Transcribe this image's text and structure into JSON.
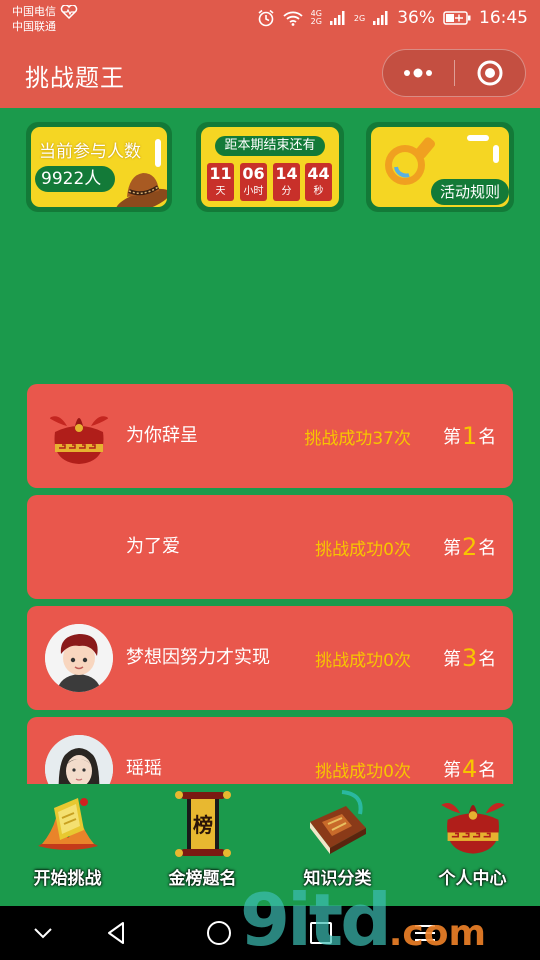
{
  "status_bar": {
    "carrier1": "中国电信",
    "carrier2": "中国联通",
    "net1": "4G",
    "net2": "2G",
    "battery": "36%",
    "time": "16:45"
  },
  "title_bar": {
    "title": "挑战题王"
  },
  "cards": {
    "participants": {
      "label": "当前参与人数",
      "count": "9922人"
    },
    "countdown": {
      "heading": "距本期结束还有",
      "units": [
        {
          "num": "11",
          "unit": "天"
        },
        {
          "num": "06",
          "unit": "小时"
        },
        {
          "num": "14",
          "unit": "分"
        },
        {
          "num": "44",
          "unit": "秒"
        }
      ]
    },
    "rules": {
      "label": "活动规则"
    }
  },
  "ranking": [
    {
      "name": "为你辞呈",
      "score": "挑战成功37次",
      "prefix": "第",
      "rank": "1",
      "suffix": "名",
      "avatar": "lucky-bag-icon"
    },
    {
      "name": "为了爱",
      "score": "挑战成功0次",
      "prefix": "第",
      "rank": "2",
      "suffix": "名",
      "avatar": ""
    },
    {
      "name": "梦想因努力才实现",
      "score": "挑战成功0次",
      "prefix": "第",
      "rank": "3",
      "suffix": "名",
      "avatar": "cartoon-boy"
    },
    {
      "name": "瑶瑶",
      "score": "挑战成功0次",
      "prefix": "第",
      "rank": "4",
      "suffix": "名",
      "avatar": "girl-photo"
    }
  ],
  "tabs": [
    {
      "label": "开始挑战",
      "icon": "trophy-icon"
    },
    {
      "label": "金榜题名",
      "icon": "scroll-icon",
      "icon_text": "榜"
    },
    {
      "label": "知识分类",
      "icon": "book-icon"
    },
    {
      "label": "个人中心",
      "icon": "lucky-bag-icon"
    }
  ],
  "watermark": {
    "main": "9itd",
    "tld": ".com"
  },
  "colors": {
    "header": "#e05a4b",
    "background": "#1b9a4c",
    "card_yellow": "#f5d623",
    "rank_card": "#e9574c",
    "accent_gold": "#f7c600"
  }
}
